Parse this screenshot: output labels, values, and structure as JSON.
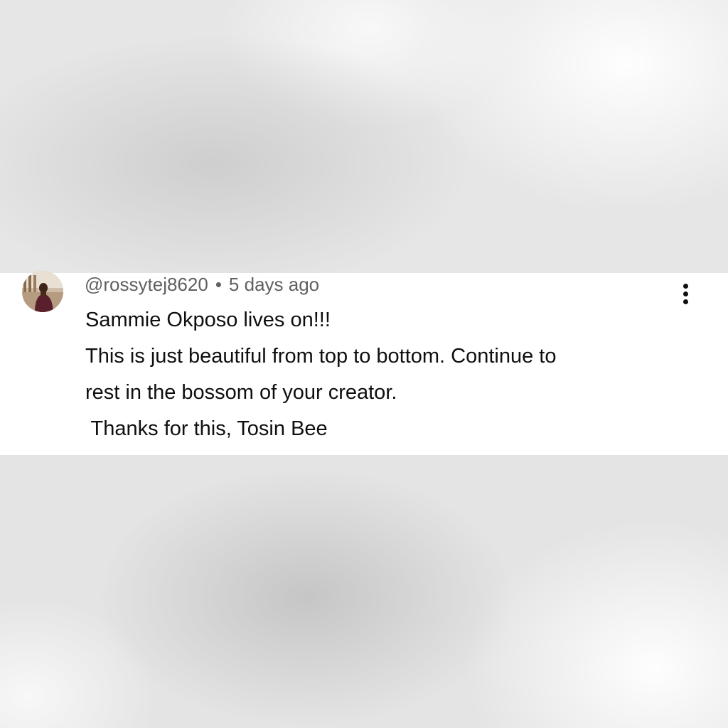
{
  "comment": {
    "author": "@rossytej8620",
    "separator": "•",
    "timestamp": "5 days ago",
    "lines": [
      "Sammie Okposo lives on!!!",
      "This is just beautiful from top to bottom. Continue to",
      "rest in the bossom of your creator.",
      " Thanks for this, Tosin Bee"
    ],
    "more_icon": "more-vertical-icon"
  },
  "colors": {
    "card_background": "#ffffff",
    "text_primary": "#0f0f0f",
    "text_secondary": "#606060",
    "page_background": "#e6e6e6"
  }
}
